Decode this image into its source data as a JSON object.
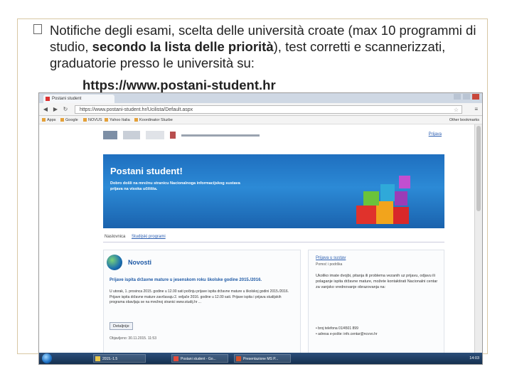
{
  "slide": {
    "bullet_text_1": "Notifiche degli esami, scelta delle università croate (max 10 programmi di studio, ",
    "bullet_text_bold": "secondo la lista delle priorità",
    "bullet_text_2": "), test corretti e scannerizzati, graduatorie presso le università su:",
    "url": "https://www.postani-student.hr"
  },
  "browser": {
    "tab_title": "Postani student",
    "address": "https://www.postani-student.hr/Ucilista/Default.aspx",
    "bookmarks": [
      "Apps",
      "Google",
      "NOVUS",
      "Yahoo Italia",
      "Koordinator Sluzbe"
    ],
    "other_bookmarks": "Other bookmarks"
  },
  "site": {
    "top_link": "Prijava",
    "hero_title": "Postani student!",
    "hero_subtitle": "Dobro došli na mrežnu stranicu Nacionalnoga informacijskog sustava prijava na visoka učilišta.",
    "subnav_home": "Naslovnica",
    "subnav_link": "Studijski programi",
    "news_title": "Novosti",
    "news_heading": "Prijave ispita državne mature u jesenskom roku školske godine 2015./2016.",
    "news_body": "U utorak, 1. prosinca 2015. godine u 12.00 sati počinju prijave ispita državne mature u školskoj godini 2015./2016. Prijave ispita državne mature završavaju 2. veljače 2016. godine u 12.00 sati. Prijave ispita i prijava studijskih programa obavljaju se na mrežnoj stranici www.studij.hr ...",
    "news_button": "Detaljnije",
    "news_date": "Objavljeno: 30.11.2015. 11:53",
    "side_link": "Prijava u sustav",
    "side_sub": "Pomoć i podrška",
    "side_body": "Ukoliko imate dvojbi, pitanja ili problema vezanih uz prijavu, odjavu ili polaganje ispita državne mature, možete kontaktirati Nacionalni centar za vanjsko vrednovanje obrazovanja na:",
    "side_contact_1": "broj telefona 01/4501 899",
    "side_contact_2": "adresa e-pošte: info.centar@ncvvo.hr"
  },
  "taskbar": {
    "tasks": [
      "2015.-1.5",
      "Postani student - Go...",
      "Presentazione MS P..."
    ],
    "clock": "14:03"
  },
  "colors": {
    "hero_blue": "#2c8ad6",
    "link_blue": "#2a5db0",
    "frame_border": "#d8c7a3"
  }
}
